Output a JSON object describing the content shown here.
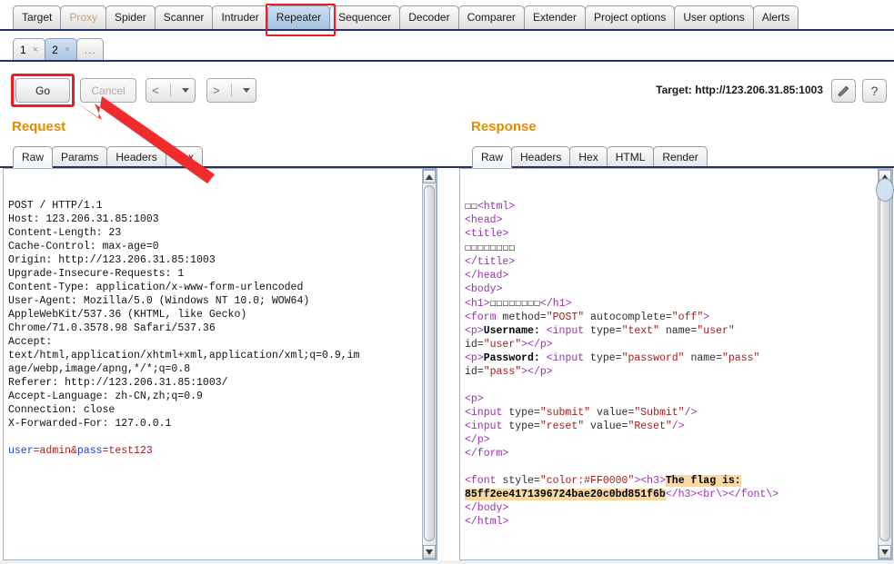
{
  "main_tabs": [
    {
      "label": "Target",
      "state": "normal"
    },
    {
      "label": "Proxy",
      "state": "dim"
    },
    {
      "label": "Spider",
      "state": "normal"
    },
    {
      "label": "Scanner",
      "state": "normal"
    },
    {
      "label": "Intruder",
      "state": "normal"
    },
    {
      "label": "Repeater",
      "state": "selected"
    },
    {
      "label": "Sequencer",
      "state": "normal"
    },
    {
      "label": "Decoder",
      "state": "normal"
    },
    {
      "label": "Comparer",
      "state": "normal"
    },
    {
      "label": "Extender",
      "state": "normal"
    },
    {
      "label": "Project options",
      "state": "normal"
    },
    {
      "label": "User options",
      "state": "normal"
    },
    {
      "label": "Alerts",
      "state": "normal"
    }
  ],
  "sub_tabs": [
    {
      "label": "1",
      "close": "×",
      "state": "normal"
    },
    {
      "label": "2",
      "close": "×",
      "state": "selected"
    },
    {
      "label": "...",
      "close": "",
      "state": "add"
    }
  ],
  "toolbar": {
    "go_label": "Go",
    "cancel_label": "Cancel",
    "prev_label": "<",
    "next_label": ">",
    "target_label": "Target: http://123.206.31.85:1003",
    "pencil_icon": "pencil-icon",
    "help_icon": "question-mark-icon"
  },
  "request": {
    "title": "Request",
    "tabs": [
      {
        "label": "Raw",
        "state": "selected"
      },
      {
        "label": "Params",
        "state": "normal"
      },
      {
        "label": "Headers",
        "state": "normal"
      },
      {
        "label": "Hex",
        "state": "normal"
      }
    ],
    "lines": [
      "POST / HTTP/1.1",
      "Host: 123.206.31.85:1003",
      "Content-Length: 23",
      "Cache-Control: max-age=0",
      "Origin: http://123.206.31.85:1003",
      "Upgrade-Insecure-Requests: 1",
      "Content-Type: application/x-www-form-urlencoded",
      "User-Agent: Mozilla/5.0 (Windows NT 10.0; WOW64)",
      "AppleWebKit/537.36 (KHTML, like Gecko)",
      "Chrome/71.0.3578.98 Safari/537.36",
      "Accept:",
      "text/html,application/xhtml+xml,application/xml;q=0.9,im",
      "age/webp,image/apng,*/*;q=0.8",
      "Referer: http://123.206.31.85:1003/",
      "Accept-Language: zh-CN,zh;q=0.9",
      "Connection: close",
      "X-Forwarded-For: 127.0.0.1"
    ],
    "body_param1_name": "user",
    "body_param1_value": "=admin&",
    "body_param2_name": "pass",
    "body_param2_value": "=test123"
  },
  "response": {
    "title": "Response",
    "tabs": [
      {
        "label": "Raw",
        "state": "selected"
      },
      {
        "label": "Headers",
        "state": "normal"
      },
      {
        "label": "Hex",
        "state": "normal"
      },
      {
        "label": "HTML",
        "state": "normal"
      },
      {
        "label": "Render",
        "state": "normal"
      }
    ],
    "bom": "☐☐",
    "l_html_open": "<html>",
    "l_head_open": "<head>",
    "l_title_open": "<title>",
    "l_title_text": "☐☐☐☐☐☐☐☐",
    "l_title_close": "</title>",
    "l_head_close": "</head>",
    "l_body_open": "<body>",
    "l_h1_open": "<h1>",
    "l_h1_text": "☐☐☐☐☐☐☐☐",
    "l_h1_close": "</h1>",
    "l_form_open": "<form ",
    "l_form_attr1": "method=",
    "l_form_val1": "\"POST\"",
    "l_form_attr2": " autocomplete=",
    "l_form_val2": "\"off\"",
    "l_gt": ">",
    "l_p_open": "<p>",
    "l_user_text": "Username: ",
    "l_input_open": "<input ",
    "l_type_attr": "type=",
    "l_type_text_val": "\"text\"",
    "l_name_attr": " name=",
    "l_name_user_val": "\"user\"",
    "l_id_attr": "id=",
    "l_id_user_val": "\"user\"",
    "l_p_close": "></p>",
    "l_pass_text": "Password: ",
    "l_type_pass_val": "\"password\"",
    "l_name_pass_val": "\"pass\"",
    "l_id_pass_val": "\"pass\"",
    "l_p_bare": "<p>",
    "l_submit_val_attr": " value=",
    "l_submit_type": "\"submit\"",
    "l_submit_value": "\"Submit\"",
    "l_selfclose": "/>",
    "l_reset_type": "\"reset\"",
    "l_reset_value": "\"Reset\"",
    "l_p_close_tag": "</p>",
    "l_form_close": "</form>",
    "l_font_open": "<font ",
    "l_font_style_attr": "style=",
    "l_font_style_val": "\"color:#FF0000\"",
    "l_h3_open": "<h3>",
    "l_flag_text": "The flag is:",
    "l_flag_hash": "85ff2ee4171396724bae20c0bd851f6b",
    "l_h3_close": "</h3>",
    "l_br": "<br\\>",
    "l_font_close": "</font\\>",
    "l_body_close": "</body>",
    "l_html_close": "</html>"
  },
  "colors": {
    "accent_orange": "#e48b00",
    "annotation_red": "#ec1c24",
    "tag_purple": "#9b30b0",
    "value_red": "#9e1b1b",
    "key_blue": "#1b3fd1",
    "flag_highlight": "#fbd9a5",
    "selected_tab_blue": "#b3cde6",
    "panel_border_blue": "#24306b"
  }
}
